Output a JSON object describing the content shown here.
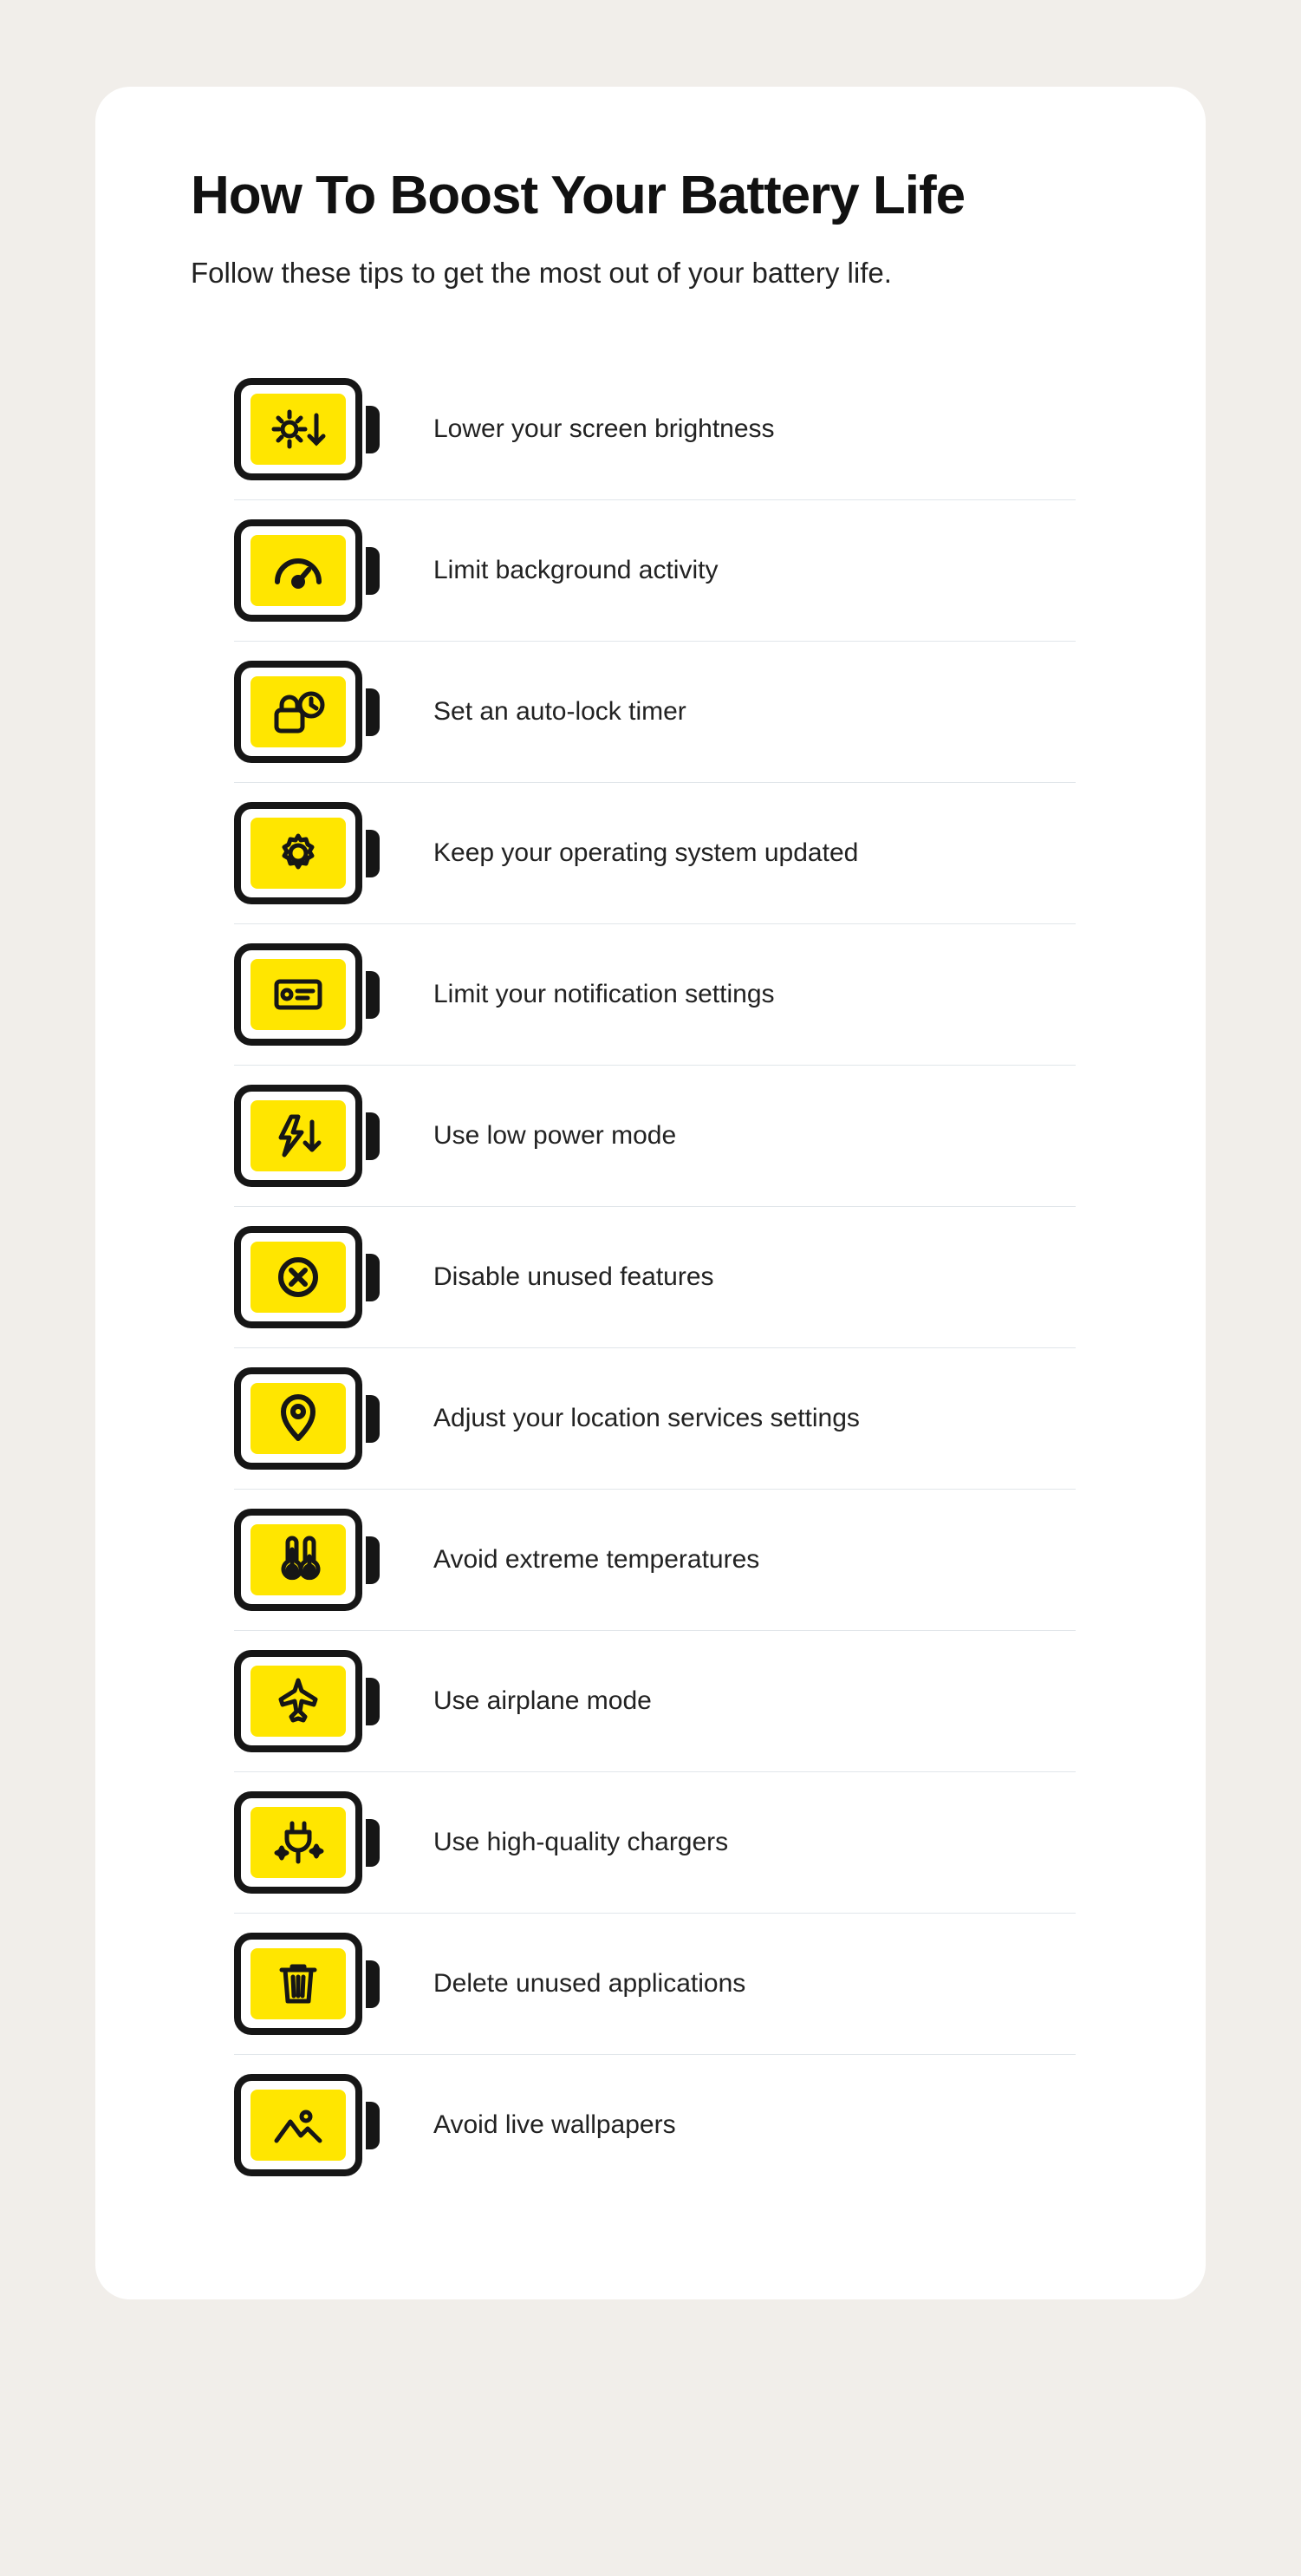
{
  "title": "How To Boost Your Battery Life",
  "subtitle": "Follow these tips to get the most out of your battery life.",
  "tips": [
    {
      "label": "Lower your screen brightness"
    },
    {
      "label": "Limit background activity"
    },
    {
      "label": "Set an auto-lock timer"
    },
    {
      "label": "Keep your operating system updated"
    },
    {
      "label": "Limit your notification settings"
    },
    {
      "label": "Use low power mode"
    },
    {
      "label": "Disable unused features"
    },
    {
      "label": "Adjust your location services settings"
    },
    {
      "label": "Avoid extreme temperatures"
    },
    {
      "label": "Use airplane mode"
    },
    {
      "label": "Use high-quality chargers"
    },
    {
      "label": "Delete unused applications"
    },
    {
      "label": "Avoid live wallpapers"
    }
  ]
}
